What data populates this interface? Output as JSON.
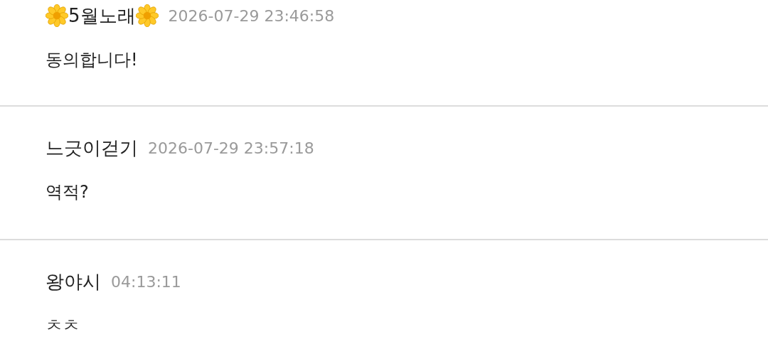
{
  "comments": [
    {
      "author": "5월노래",
      "decorated": true,
      "time": "2026-07-29 23:46:58",
      "text": "동의합니다!"
    },
    {
      "author": "느긋이걷기",
      "decorated": false,
      "time": "2026-07-29 23:57:18",
      "text": "역적?"
    },
    {
      "author": "왕야시",
      "decorated": false,
      "time": "04:13:11",
      "text": "ㅊㅊ"
    }
  ]
}
